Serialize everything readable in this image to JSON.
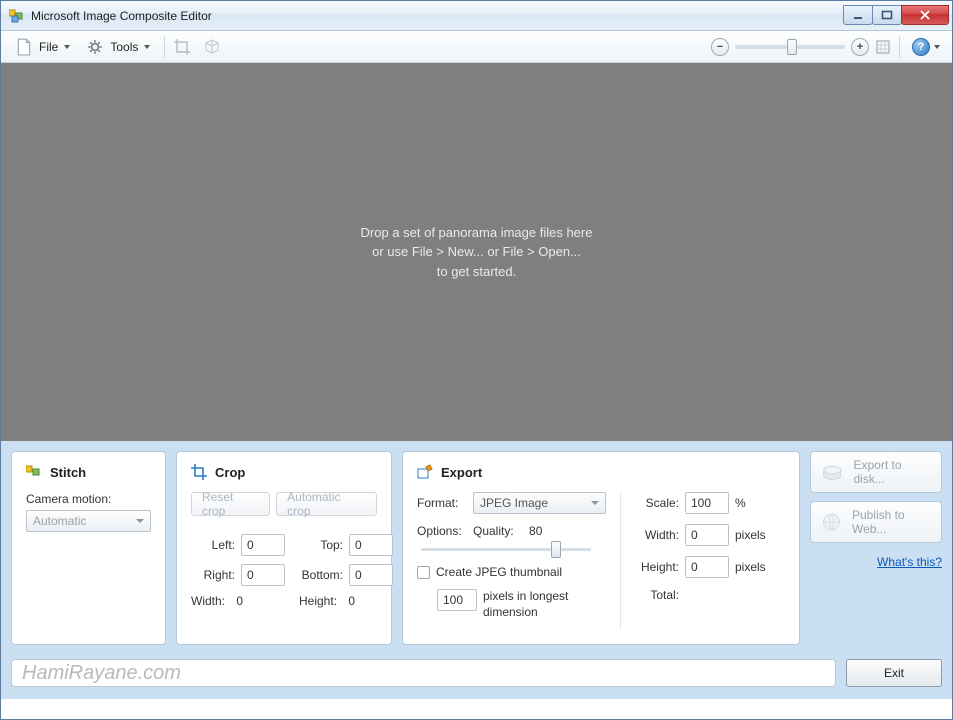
{
  "window": {
    "title": "Microsoft Image Composite Editor"
  },
  "menu": {
    "file": "File",
    "tools": "Tools"
  },
  "zoom": {
    "out": "−",
    "in": "+",
    "help": "?"
  },
  "canvas": {
    "line1": "Drop a set of panorama image files here",
    "line2": "or use File > New... or File > Open...",
    "line3": "to get started."
  },
  "stitch": {
    "title": "Stitch",
    "camera_motion_label": "Camera motion:",
    "camera_motion_value": "Automatic"
  },
  "crop": {
    "title": "Crop",
    "reset_btn": "Reset crop",
    "auto_btn": "Automatic crop",
    "left_label": "Left:",
    "left": "0",
    "top_label": "Top:",
    "top": "0",
    "right_label": "Right:",
    "right": "0",
    "bottom_label": "Bottom:",
    "bottom": "0",
    "width_label": "Width:",
    "width": "0",
    "height_label": "Height:",
    "height": "0"
  },
  "export": {
    "title": "Export",
    "format_label": "Format:",
    "format_value": "JPEG Image",
    "options_label": "Options:",
    "quality_label": "Quality:",
    "quality_value": "80",
    "create_thumbnail": "Create JPEG thumbnail",
    "thumb_px": "100",
    "thumb_suffix": "pixels in longest dimension",
    "scale_label": "Scale:",
    "scale": "100",
    "scale_unit": "%",
    "width_label": "Width:",
    "width": "0",
    "width_unit": "pixels",
    "height_label": "Height:",
    "height": "0",
    "height_unit": "pixels",
    "total_label": "Total:"
  },
  "side": {
    "export_disk": "Export to disk...",
    "publish_web": "Publish to Web...",
    "whats_this": "What's this?"
  },
  "status": {
    "watermark": "HamiRayane.com",
    "exit": "Exit"
  }
}
